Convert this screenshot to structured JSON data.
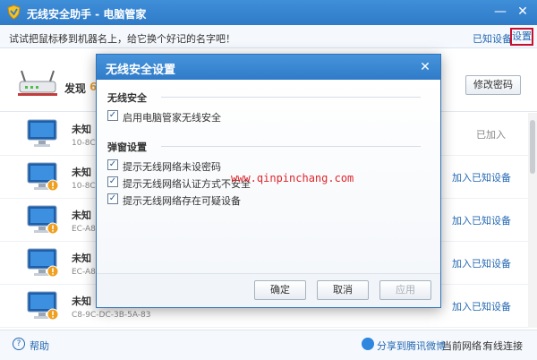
{
  "window": {
    "title": "无线安全助手 - 电脑管家",
    "minimize_label": "—",
    "close_label": "✕"
  },
  "hint_bar": {
    "text": "试试把鼠标移到机器名上，给它换个好记的名字吧！",
    "known_devices_link": "已知设备",
    "settings_link": "设置"
  },
  "discovery": {
    "label": "发现",
    "count": "6"
  },
  "header_button": {
    "modify_password": "修改密码"
  },
  "devices": [
    {
      "name": "未知",
      "mac": "10-8C-",
      "action": "已加入"
    },
    {
      "name": "未知",
      "mac": "10-8C-",
      "action": "加入已知设备"
    },
    {
      "name": "未知",
      "mac": "EC-A8-",
      "action": "加入已知设备"
    },
    {
      "name": "未知",
      "mac": "EC-A8-",
      "action": "加入已知设备"
    },
    {
      "name": "未知",
      "mac": "C8-9C-DC-3B-5A-83",
      "action": "加入已知设备"
    }
  ],
  "footer": {
    "help": "帮助",
    "share": "分享到腾讯微博",
    "current_network_label": "当前网络：",
    "current_network_value": "有线连接"
  },
  "modal": {
    "title": "无线安全设置",
    "close_label": "✕",
    "wireless_section": "无线安全",
    "wireless_enable": "启用电脑管家无线安全",
    "popup_section": "弹窗设置",
    "options": [
      "提示无线网络未设密码",
      "提示无线网络认证方式不安全",
      "提示无线网络存在可疑设备"
    ],
    "ok": "确定",
    "cancel": "取消",
    "apply": "应用",
    "check_mark": "✓"
  },
  "watermark": "www.qinpinchang.com",
  "colors": {
    "title_blue": "#2f7bc8",
    "link_blue": "#2569b3",
    "highlight_red": "#c8102e",
    "watermark_red": "#e0262b"
  }
}
